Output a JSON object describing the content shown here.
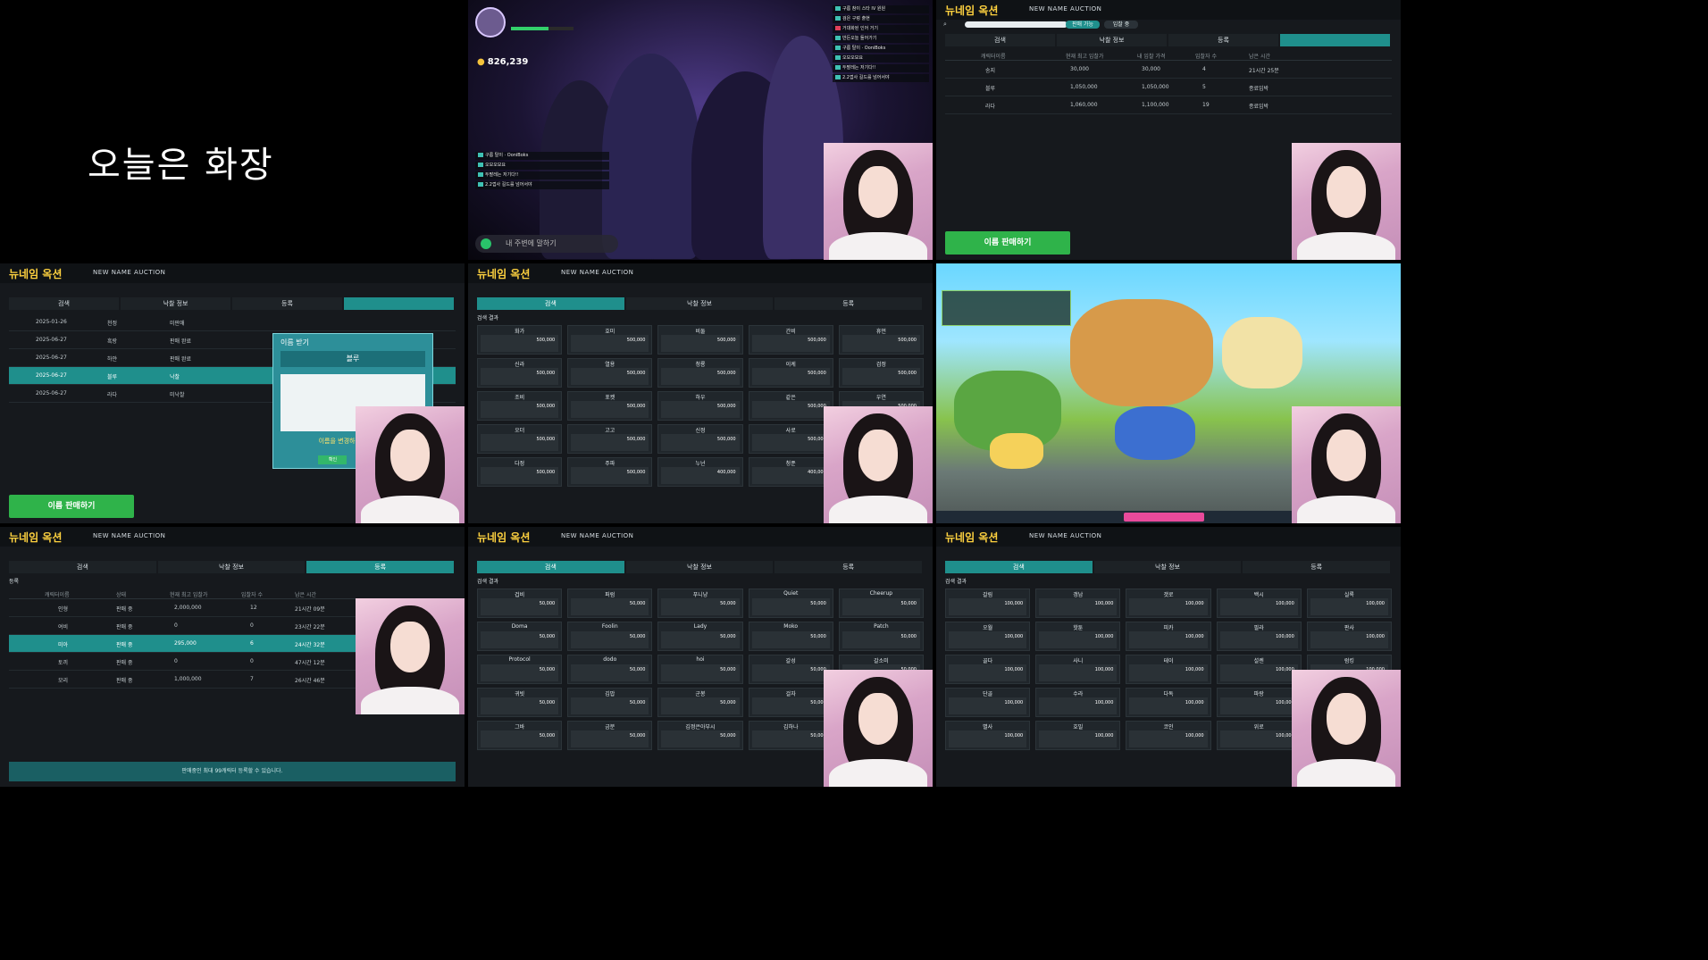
{
  "caption": "오늘은 화장",
  "auction": {
    "title": "뉴네임 옥션",
    "subtitle": "NEW NAME AUCTION",
    "search_label": "검색",
    "pill_free": "판매 가능",
    "pill_cond": "입찰 중",
    "tab_search": "검색",
    "tab_bid": "낙찰 정보",
    "tab_reg": "등록",
    "sell_button": "이름 판매하기",
    "result_label": "검색 결과",
    "reg_label": "등록",
    "close_label": "나가기"
  },
  "p3": {
    "heads": [
      "캐릭터이름",
      "현재 최고 입찰가",
      "내 입찰 가격",
      "입찰자 수",
      "남은 시간"
    ],
    "rows": [
      {
        "name": "송지",
        "bid": "30,000",
        "mine": "30,000",
        "cnt": "4",
        "time": "21시간 25분"
      },
      {
        "name": "블루",
        "bid": "1,050,000",
        "mine": "1,050,000",
        "cnt": "5",
        "time": "종료임박"
      },
      {
        "name": "라다",
        "bid": "1,060,000",
        "mine": "1,100,000",
        "cnt": "19",
        "time": "종료임박"
      }
    ]
  },
  "p4": {
    "popup_title": "이름 받기",
    "popup_name": "블루",
    "popup_question": "이름을 변경하시겠습니까?",
    "ok": "확인",
    "cancel": "취소",
    "rows": [
      {
        "date": "2025-01-26",
        "name": "천정",
        "state": "미판매"
      },
      {
        "date": "2025-06-27",
        "name": "흑랑",
        "state": "판매 완료"
      },
      {
        "date": "2025-06-27",
        "name": "하얀",
        "state": "판매 완료"
      },
      {
        "date": "2025-06-27",
        "name": "블루",
        "state": "낙찰"
      },
      {
        "date": "2025-06-27",
        "name": "라다",
        "state": "미낙찰"
      }
    ]
  },
  "p5": {
    "names": [
      "화가",
      "호미",
      "비둘",
      "간비",
      "휴먼",
      "신라",
      "열용",
      "청룡",
      "이케",
      "검정",
      "조비",
      "포켓",
      "하우",
      "같은",
      "우연",
      "오더",
      "고고",
      "신정",
      "사로",
      "장신",
      "다정",
      "주파",
      "누넌",
      "청푼",
      "창공"
    ],
    "price": "500,000",
    "low": "400,000"
  },
  "p7": {
    "rows": [
      {
        "name": "인형",
        "state": "판매 중",
        "bid": "2,000,000",
        "cnt": "12",
        "time": "21시간 09분"
      },
      {
        "name": "여비",
        "state": "판매 중",
        "bid": "0",
        "cnt": "0",
        "time": "23시간 22분"
      },
      {
        "name": "미아",
        "state": "판매 중",
        "bid": "295,000",
        "cnt": "6",
        "time": "24시간 32분"
      },
      {
        "name": "토끼",
        "state": "판매 중",
        "bid": "0",
        "cnt": "0",
        "time": "47시간 12분"
      },
      {
        "name": "모리",
        "state": "판매 중",
        "bid": "1,000,000",
        "cnt": "7",
        "time": "26시간 46분"
      }
    ],
    "heads": [
      "캐릭터이름",
      "상태",
      "현재 최고 입찰가",
      "입찰자 수",
      "남은 시간"
    ],
    "footer": "판매중인 최대 99캐릭터 등록할 수 있습니다."
  },
  "p8": {
    "names": [
      "겁비",
      "퍼럼",
      "푸니냥",
      "Quiet",
      "Cheerup",
      "Doma",
      "Foolin",
      "Lady",
      "Moko",
      "Patch",
      "Protocol",
      "dodo",
      "hoi",
      "갈성",
      "갈소미",
      "귀빗",
      "김밥",
      "군봉",
      "걸자",
      "굿으리",
      "그바",
      "금분",
      "김정은아부시",
      "김하나",
      "까치네"
    ],
    "price": "50,000"
  },
  "p9": {
    "names": [
      "갈림",
      "갱남",
      "갯로",
      "백시",
      "실록",
      "오월",
      "핫툰",
      "피카",
      "필라",
      "판사",
      "골다",
      "사니",
      "테이",
      "설렌",
      "럼킹",
      "단골",
      "수라",
      "다독",
      "파랑",
      "냥냥",
      "별사",
      "호밀",
      "코인",
      "위로",
      "휴일"
    ],
    "price": "100,000"
  },
  "chat": {
    "lines": [
      "구름 참이 스타 IV 원원",
      "검은 구렁 출현",
      "거대화된 인어 거기",
      "반든오늘 들어가기",
      "구름 탈이 · OoniBoks",
      "오모오모요",
      "두팔레는 저기다!!",
      "2.2껍사 길드를 넘어서야"
    ]
  },
  "game1": {
    "coins": "826,239",
    "say_placeholder": "내 주변에 말하기"
  }
}
